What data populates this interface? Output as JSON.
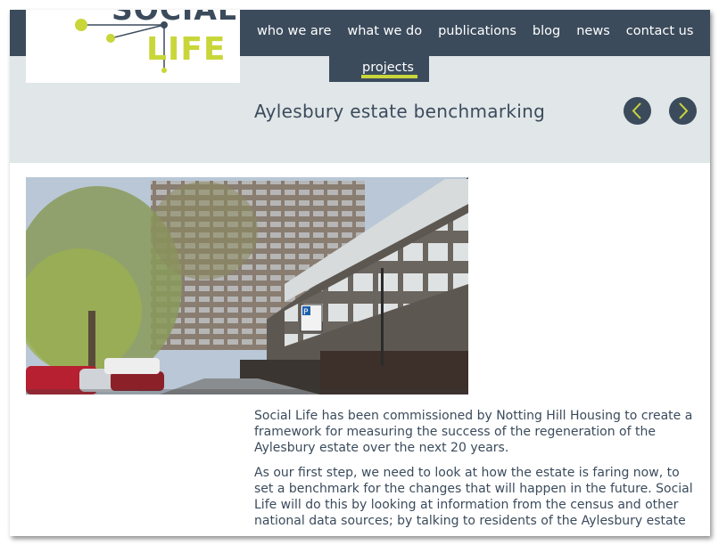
{
  "colors": {
    "navy": "#3b4b5c",
    "light_band": "#e1e6e8",
    "lime": "#c9d63a",
    "text": "#3b4b5c"
  },
  "logo": {
    "line1": "SOCIAL",
    "line2": "LIFE"
  },
  "nav": {
    "items": [
      "who we are",
      "what we do",
      "publications",
      "blog",
      "news",
      "contact us"
    ],
    "active_sub": "projects"
  },
  "project": {
    "title": "Aylesbury estate benchmarking",
    "prev_icon": "chevron-left-icon",
    "next_icon": "chevron-right-icon"
  },
  "content": {
    "paragraphs": [
      "Social Life has been commissioned by Notting Hill Housing to create a framework for measuring the success of the regeneration of the Aylesbury estate over the next 20 years.",
      "As our first step, we need to look at how the estate is faring now, to set a benchmark for the changes that will happen in the future. Social Life will do this by looking at information from the census and other national data sources; by talking to residents of the Aylesbury estate"
    ]
  },
  "photo": {
    "sign_text": "P"
  }
}
